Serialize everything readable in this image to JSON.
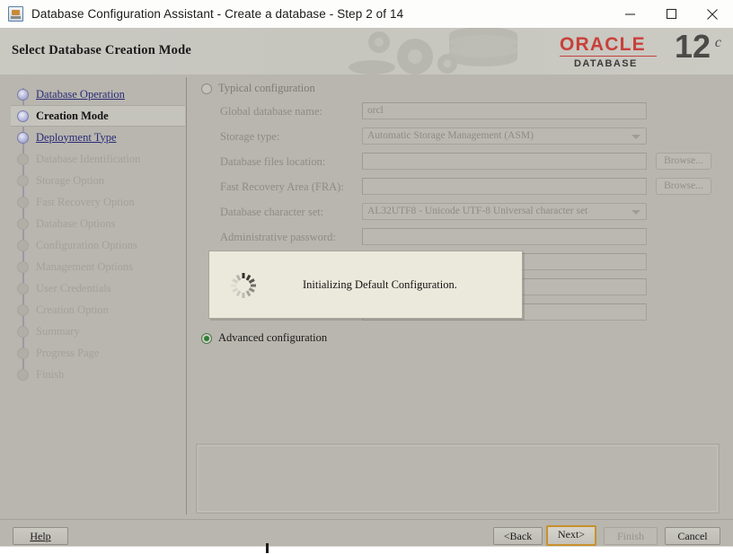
{
  "window": {
    "title": "Database Configuration Assistant - Create a database - Step 2 of 14",
    "icon": "oracle-dbca-icon",
    "minimize_label": "Minimize",
    "maximize_label": "Maximize",
    "close_label": "Close"
  },
  "banner": {
    "title": "Select Database Creation Mode",
    "brand": "ORACLE",
    "brand_sub": "DATABASE",
    "version": "12",
    "version_suffix": "c",
    "brand_color": "#c8403a"
  },
  "sidebar": {
    "items": [
      {
        "label": "Database Operation",
        "state": "done"
      },
      {
        "label": "Creation Mode",
        "state": "current"
      },
      {
        "label": "Deployment Type",
        "state": "done"
      },
      {
        "label": "Database Identification",
        "state": "disabled"
      },
      {
        "label": "Storage Option",
        "state": "disabled"
      },
      {
        "label": "Fast Recovery Option",
        "state": "disabled"
      },
      {
        "label": "Database Options",
        "state": "disabled"
      },
      {
        "label": "Configuration Options",
        "state": "disabled"
      },
      {
        "label": "Management Options",
        "state": "disabled"
      },
      {
        "label": "User Credentials",
        "state": "disabled"
      },
      {
        "label": "Creation Option",
        "state": "disabled"
      },
      {
        "label": "Summary",
        "state": "disabled"
      },
      {
        "label": "Progress Page",
        "state": "disabled"
      },
      {
        "label": "Finish",
        "state": "disabled"
      }
    ]
  },
  "main": {
    "typical": {
      "label": "Typical configuration",
      "selected": false
    },
    "advanced": {
      "label": "Advanced configuration",
      "selected": true
    },
    "fields": [
      {
        "label": "Global database name:",
        "value": "orcl",
        "kind": "text",
        "browse": null
      },
      {
        "label": "Storage type:",
        "value": "Automatic Storage Management (ASM)",
        "kind": "select",
        "browse": null
      },
      {
        "label": "Database files location:",
        "value": "",
        "kind": "text",
        "browse": "Browse..."
      },
      {
        "label": "Fast Recovery Area (FRA):",
        "value": "",
        "kind": "text",
        "browse": "Browse..."
      },
      {
        "label": "Database character set:",
        "value": "AL32UTF8 - Unicode UTF-8 Universal character set",
        "kind": "select",
        "browse": null
      },
      {
        "label": "Administrative password:",
        "value": "",
        "kind": "text",
        "browse": null
      },
      {
        "label": "",
        "value": "",
        "kind": "text",
        "browse": null
      },
      {
        "label": "",
        "value": "",
        "kind": "text",
        "browse": null
      },
      {
        "label": "",
        "value": "",
        "kind": "text",
        "browse": null
      }
    ]
  },
  "modal": {
    "message": "Initializing Default Configuration.",
    "spinner": "loading-spinner-icon"
  },
  "footer": {
    "help": "Help",
    "back": "<Back",
    "next": "Next>",
    "finish": "Finish",
    "cancel": "Cancel"
  }
}
